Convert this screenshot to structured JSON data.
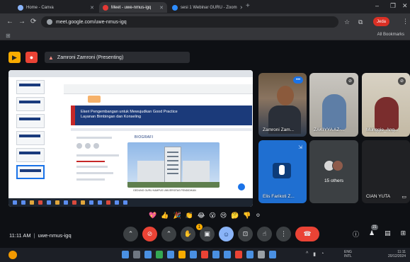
{
  "browser": {
    "tabs": [
      {
        "label": "Home - Canva"
      },
      {
        "label": "Meet - uwe-nmus-igq"
      },
      {
        "label": "sesi 1 Webinar GURU - Zoom"
      }
    ],
    "address": "meet.google.com/uwe-nmus-igq",
    "profile_label": "Jeda",
    "all_bookmarks": "All Bookmarks"
  },
  "meet": {
    "presenter_label": "Zamroni Zamroni (Presenting)",
    "meeting_code": "uwe-nmus-igq",
    "time": "11:11 AM",
    "people_count": "21",
    "participants": [
      {
        "name": "Zamroni Zam..."
      },
      {
        "name": "ZAKIYYA AZ-..."
      },
      {
        "name": "Munggie_Ang..."
      },
      {
        "name": "Elis Farikoti Z..."
      },
      {
        "name": "CIAN YUTA"
      }
    ],
    "others_label": "15 others",
    "reactions": [
      "💖",
      "👍",
      "🎉",
      "👏",
      "😂",
      "😮",
      "😢",
      "🤔",
      "👎",
      "⚪"
    ],
    "raise_hand_badge": "1"
  },
  "presentation": {
    "banner_line1": "Ekeri Pengembangan untuk Mewujudkan Good Practice",
    "banner_line2": "Layanan Bimbingan dan Konseling",
    "slide_heading": "BIOGRAFI",
    "caption": "GEDUNG GURU KAMPUS UNIVERSITAS PENDIDIKAN"
  },
  "taskbar": {
    "lang": "ENG",
    "lang2": "INTL",
    "clock": "11:11",
    "date": "20/12/2024"
  }
}
